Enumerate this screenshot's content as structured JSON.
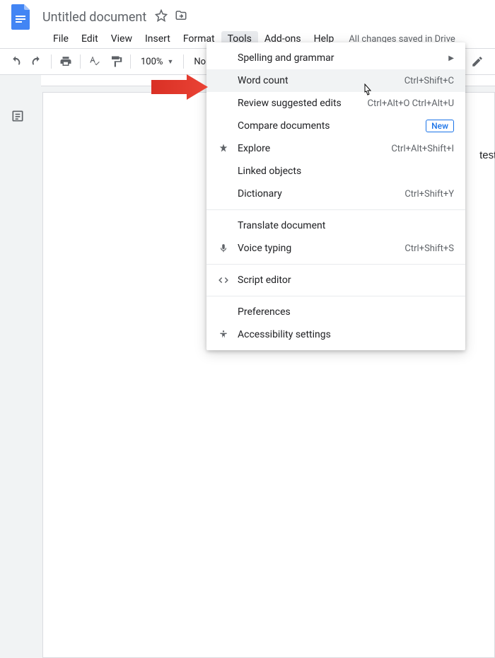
{
  "doc": {
    "title": "Untitled document",
    "save_status": "All changes saved in Drive",
    "body_text": "test te"
  },
  "menubar": {
    "file": "File",
    "edit": "Edit",
    "view": "View",
    "insert": "Insert",
    "format": "Format",
    "tools": "Tools",
    "addons": "Add-ons",
    "help": "Help"
  },
  "toolbar": {
    "zoom": "100%",
    "style": "Normal"
  },
  "tools_menu": {
    "spelling": {
      "label": "Spelling and grammar"
    },
    "word_count": {
      "label": "Word count",
      "shortcut": "Ctrl+Shift+C"
    },
    "review": {
      "label": "Review suggested edits",
      "shortcut": "Ctrl+Alt+O Ctrl+Alt+U"
    },
    "compare": {
      "label": "Compare documents",
      "badge": "New"
    },
    "explore": {
      "label": "Explore",
      "shortcut": "Ctrl+Alt+Shift+I"
    },
    "linked": {
      "label": "Linked objects"
    },
    "dictionary": {
      "label": "Dictionary",
      "shortcut": "Ctrl+Shift+Y"
    },
    "translate": {
      "label": "Translate document"
    },
    "voice": {
      "label": "Voice typing",
      "shortcut": "Ctrl+Shift+S"
    },
    "script": {
      "label": "Script editor"
    },
    "prefs": {
      "label": "Preferences"
    },
    "a11y": {
      "label": "Accessibility settings"
    }
  }
}
